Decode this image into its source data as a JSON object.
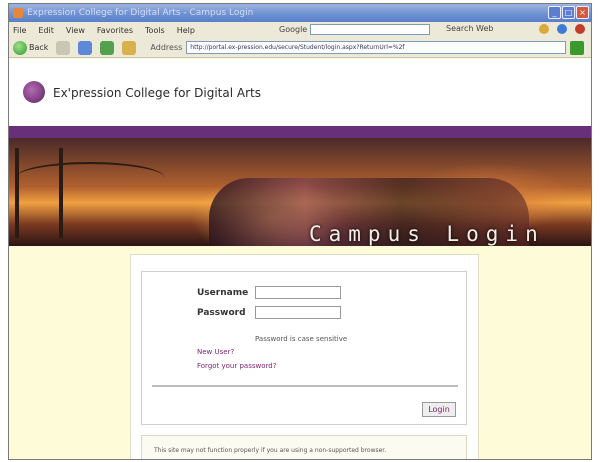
{
  "window": {
    "title": "Expression College for Digital Arts - Campus Login"
  },
  "menubar": {
    "items": [
      "File",
      "Edit",
      "View",
      "Favorites",
      "Tools",
      "Help"
    ],
    "google_label": "Google",
    "search_web": "Search Web"
  },
  "navbar": {
    "back_label": "Back",
    "address_label": "Address",
    "address_value": "http://portal.ex-pression.edu/secure/Student/login.aspx?ReturnUrl=%2f"
  },
  "page": {
    "brand": "Ex'pression College for Digital Arts",
    "banner_title": "Campus Login",
    "username_label": "Username",
    "password_label": "Password",
    "case_note": "Password is case sensitive",
    "new_user": "New User?",
    "forgot_password": "Forgot your password?",
    "login_button": "Login",
    "warning_text": "This site may not function properly if you are using a non-supported browser."
  },
  "colors": {
    "accent_purple": "#6a2f7a",
    "link_color": "#7a1f6c",
    "page_bg": "#fdfbd8"
  }
}
